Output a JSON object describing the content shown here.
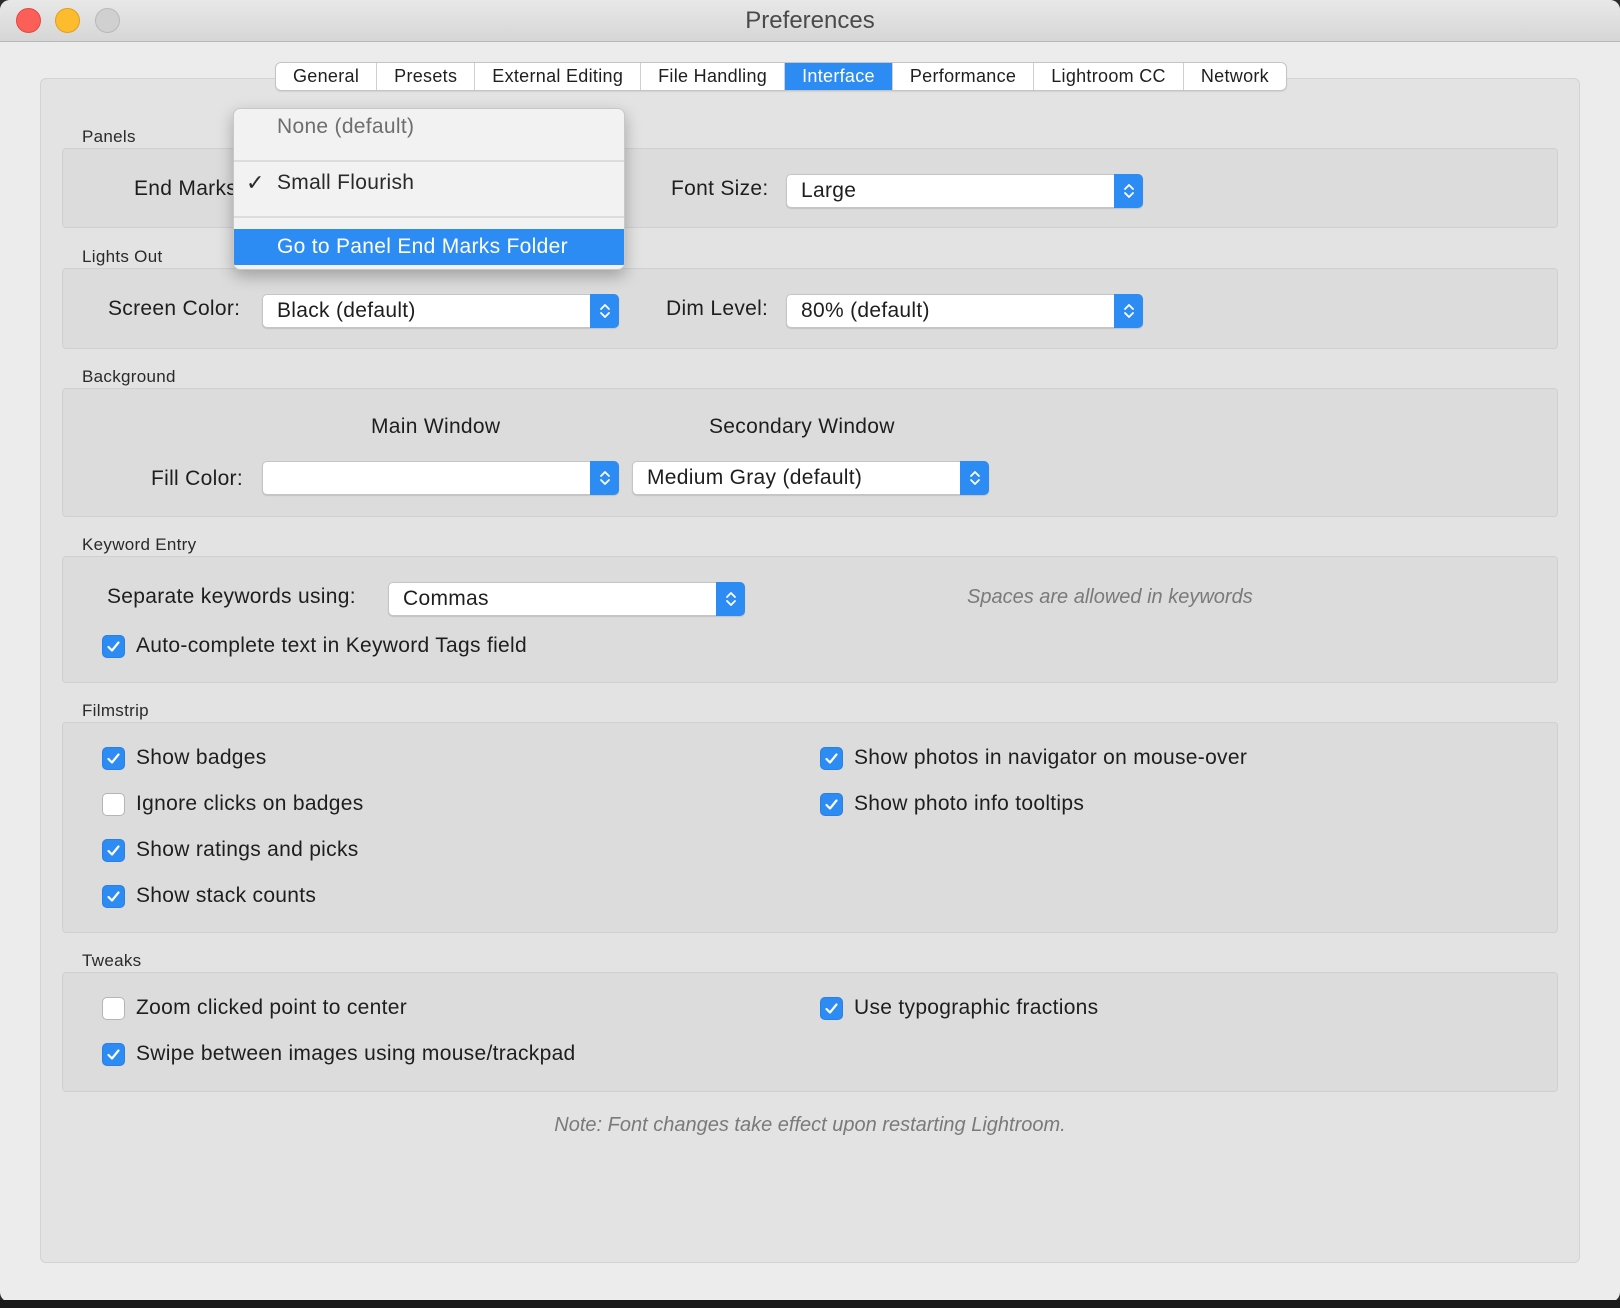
{
  "window": {
    "title": "Preferences"
  },
  "tabs": [
    "General",
    "Presets",
    "External Editing",
    "File Handling",
    "Interface",
    "Performance",
    "Lightroom CC",
    "Network"
  ],
  "active_tab": "Interface",
  "accent_color": "#2d8cf3",
  "panels": {
    "section": "Panels",
    "end_marks_label": "End Marks:",
    "font_size_label": "Font Size:",
    "font_size_value": "Large"
  },
  "end_marks_menu": {
    "items": [
      {
        "label": "None (default)",
        "checked": false,
        "highlighted": false
      },
      {
        "label": "Small Flourish",
        "checked": true,
        "highlighted": false
      },
      {
        "label": "Go to Panel End Marks Folder",
        "checked": false,
        "highlighted": true
      }
    ],
    "check_glyph": "✓"
  },
  "lights_out": {
    "section": "Lights Out",
    "screen_color_label": "Screen Color:",
    "screen_color_value": "Black (default)",
    "dim_level_label": "Dim Level:",
    "dim_level_value": "80% (default)"
  },
  "background": {
    "section": "Background",
    "main_window_heading": "Main Window",
    "secondary_window_heading": "Secondary Window",
    "fill_color_label": "Fill Color:",
    "main_fill_value": "",
    "secondary_fill_value": "Medium Gray (default)"
  },
  "keyword_entry": {
    "section": "Keyword Entry",
    "separate_label": "Separate keywords using:",
    "separate_value": "Commas",
    "hint": "Spaces are allowed in keywords",
    "autocomplete_label": "Auto-complete text in Keyword Tags field",
    "autocomplete_checked": true
  },
  "filmstrip": {
    "section": "Filmstrip",
    "left": [
      {
        "label": "Show badges",
        "checked": true
      },
      {
        "label": "Ignore clicks on badges",
        "checked": false
      },
      {
        "label": "Show ratings and picks",
        "checked": true
      },
      {
        "label": "Show stack counts",
        "checked": true
      }
    ],
    "right": [
      {
        "label": "Show photos in navigator on mouse-over",
        "checked": true
      },
      {
        "label": "Show photo info tooltips",
        "checked": true
      }
    ]
  },
  "tweaks": {
    "section": "Tweaks",
    "left": [
      {
        "label": "Zoom clicked point to center",
        "checked": false
      },
      {
        "label": "Swipe between images using mouse/trackpad",
        "checked": true
      }
    ],
    "right": [
      {
        "label": "Use typographic fractions",
        "checked": true
      }
    ]
  },
  "note": "Note: Font changes take effect upon restarting Lightroom."
}
